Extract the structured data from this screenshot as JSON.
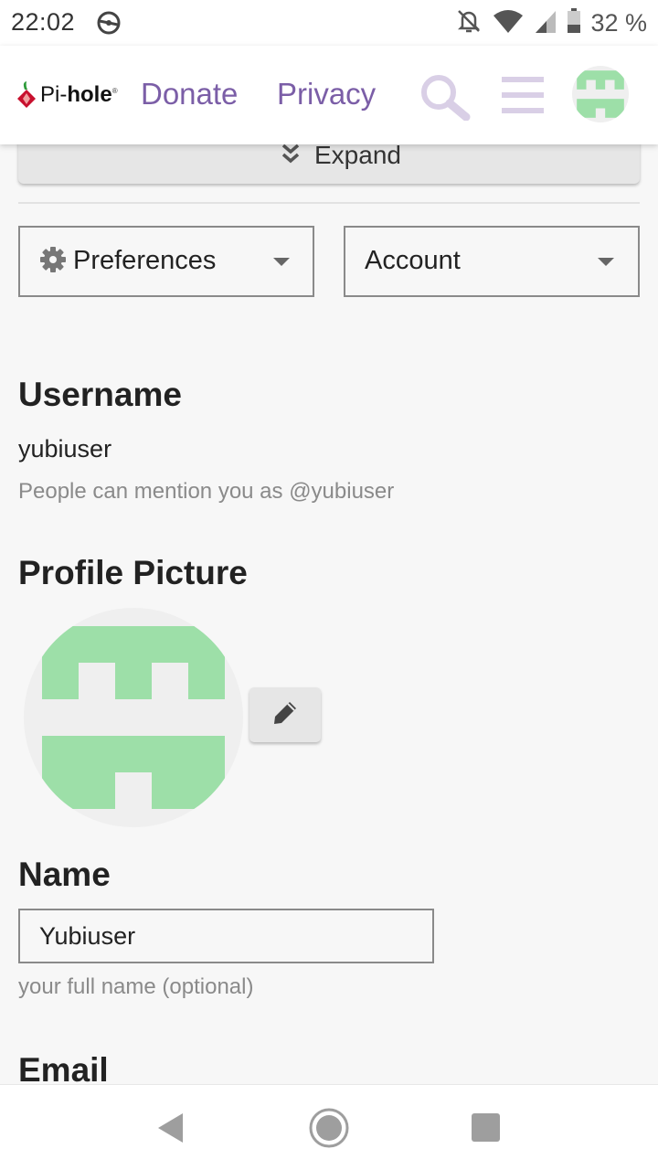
{
  "status_bar": {
    "time": "22:02",
    "battery_percent": "32 %",
    "icons": [
      "sync-icon",
      "bell-off-icon",
      "wifi-icon",
      "signal-icon",
      "battery-icon"
    ]
  },
  "header": {
    "logo_text_pi": "Pi-",
    "logo_text_hole": "hole",
    "logo_reg": "®",
    "links": {
      "donate": "Donate",
      "privacy": "Privacy"
    },
    "icons": [
      "search-icon",
      "hamburger-menu-icon",
      "avatar"
    ],
    "accent_color": "#7b5ea7",
    "icon_color": "#d9cfe6"
  },
  "expand": {
    "label": "Expand"
  },
  "selects": {
    "preferences": "Preferences",
    "account": "Account"
  },
  "username": {
    "title": "Username",
    "value": "yubiuser",
    "hint": "People can mention you as @yubiuser"
  },
  "profile_picture": {
    "title": "Profile Picture",
    "avatar_color": "#9ddfa8"
  },
  "name": {
    "title": "Name",
    "value": "Yubiuser",
    "hint": "your full name (optional)"
  },
  "email": {
    "title": "Email"
  },
  "navbar": {
    "icons": [
      "back-icon",
      "home-icon",
      "recent-apps-icon"
    ]
  }
}
